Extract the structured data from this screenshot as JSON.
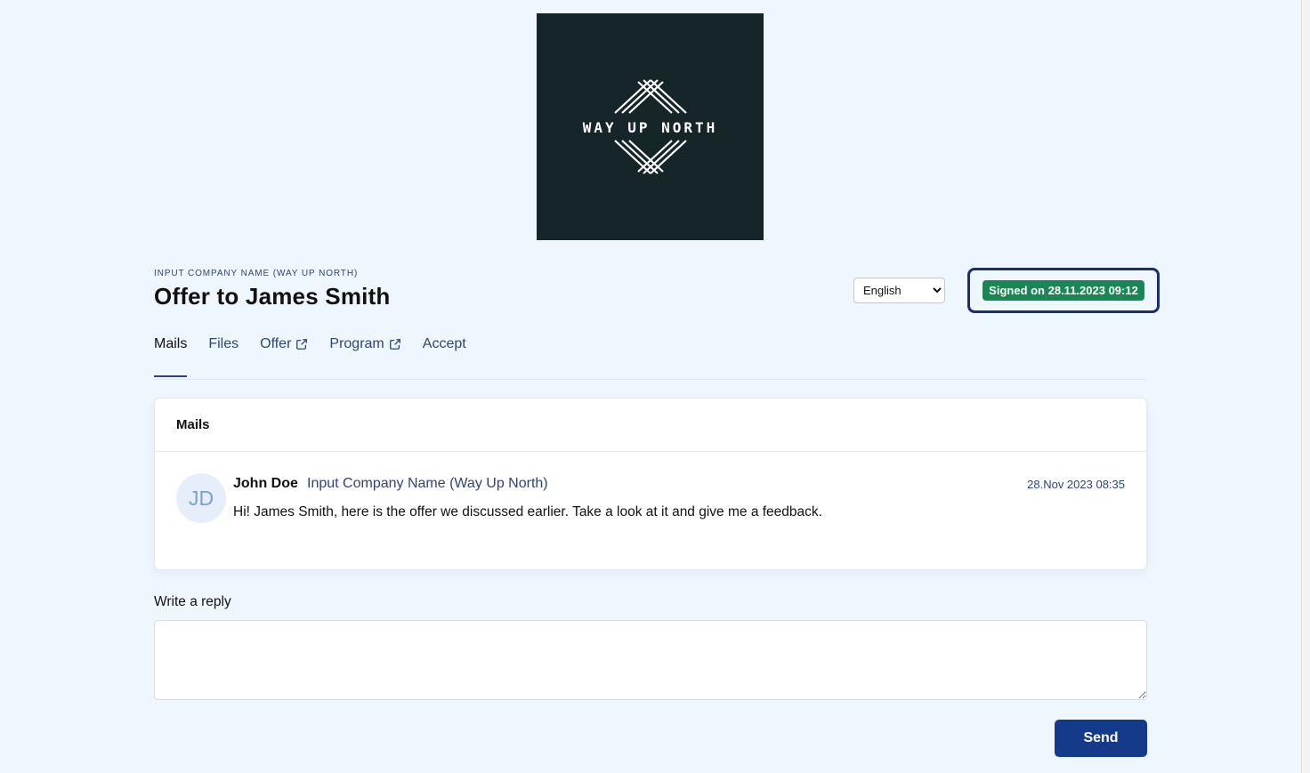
{
  "logo": {
    "text": "WAY UP NORTH",
    "background": "#152528"
  },
  "header": {
    "company_caption": "INPUT COMPANY NAME (WAY UP NORTH)",
    "title": "Offer to James Smith"
  },
  "language": {
    "selected": "English",
    "options": [
      "English"
    ]
  },
  "status": {
    "label": "Signed on 28.11.2023 09:12",
    "color": "#198754"
  },
  "tabs": [
    {
      "label": "Mails",
      "active": true,
      "external": false
    },
    {
      "label": "Files",
      "active": false,
      "external": false
    },
    {
      "label": "Offer",
      "active": false,
      "external": true,
      "icon": "external-link-icon"
    },
    {
      "label": "Program",
      "active": false,
      "external": true,
      "icon": "external-link-icon"
    },
    {
      "label": "Accept",
      "active": false,
      "external": false
    }
  ],
  "mails": {
    "heading": "Mails",
    "items": [
      {
        "initials": "JD",
        "sender": "John Doe",
        "company": "Input Company Name (Way Up North)",
        "date": "28.Nov 2023 08:35",
        "body": "Hi! James Smith, here is the offer we discussed earlier. Take a look at it and give me a feedback."
      }
    ]
  },
  "reply": {
    "label": "Write a reply",
    "value": "",
    "placeholder": ""
  },
  "send_button": {
    "label": "Send",
    "color": "#163a8a"
  },
  "accent_color": "#2e4478"
}
